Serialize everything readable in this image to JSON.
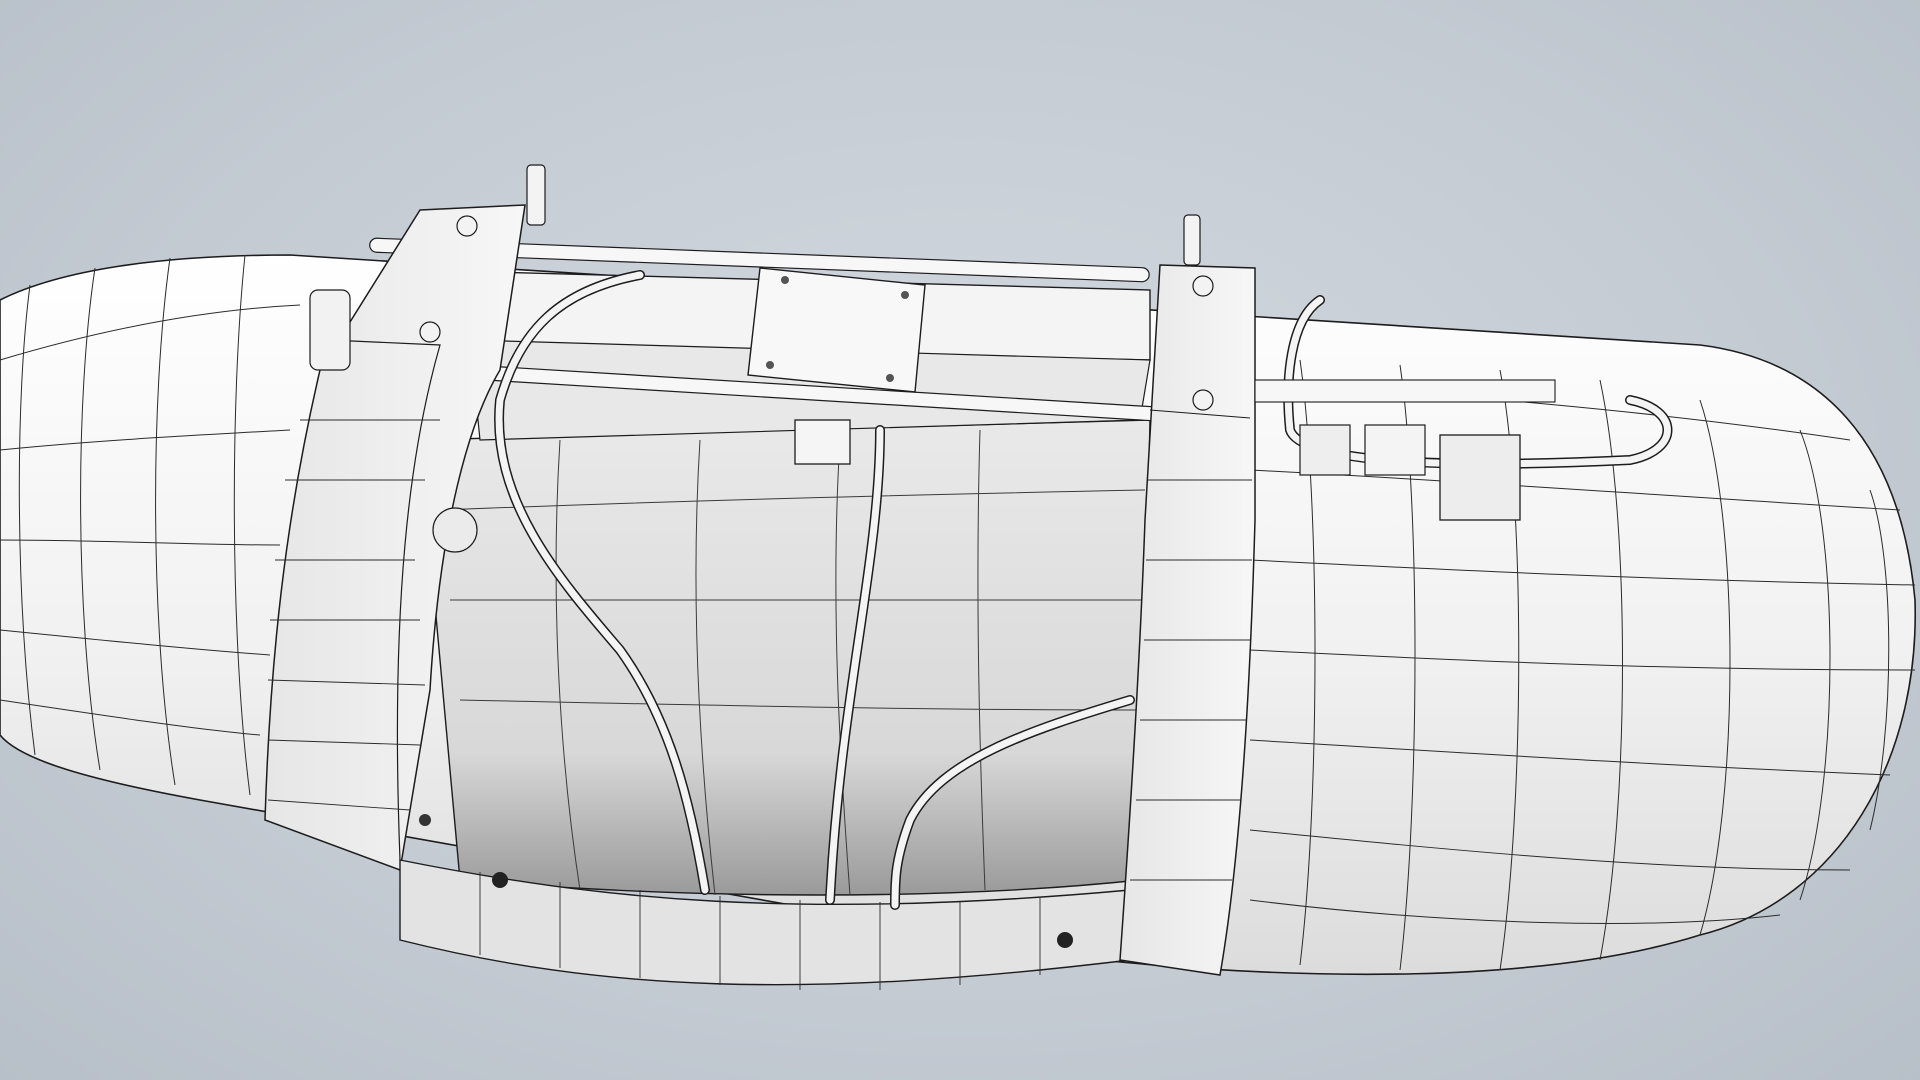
{
  "viewport": {
    "background_color": "#c7ced5",
    "model_fill_color": "#f3f3f3",
    "model_shadow_color": "#d6d6d6",
    "wire_color": "#1c1c1c",
    "render_mode": "shaded-with-edges"
  },
  "model": {
    "description_icon": "wireframe-pod-model",
    "components": [
      "capsule-hull",
      "front-ring-frame",
      "rear-ring-frame",
      "upper-rail-bar",
      "lower-rail-bar",
      "mounting-plate",
      "connector-box",
      "cable-harness",
      "actuator-motor",
      "vertical-pins"
    ]
  }
}
